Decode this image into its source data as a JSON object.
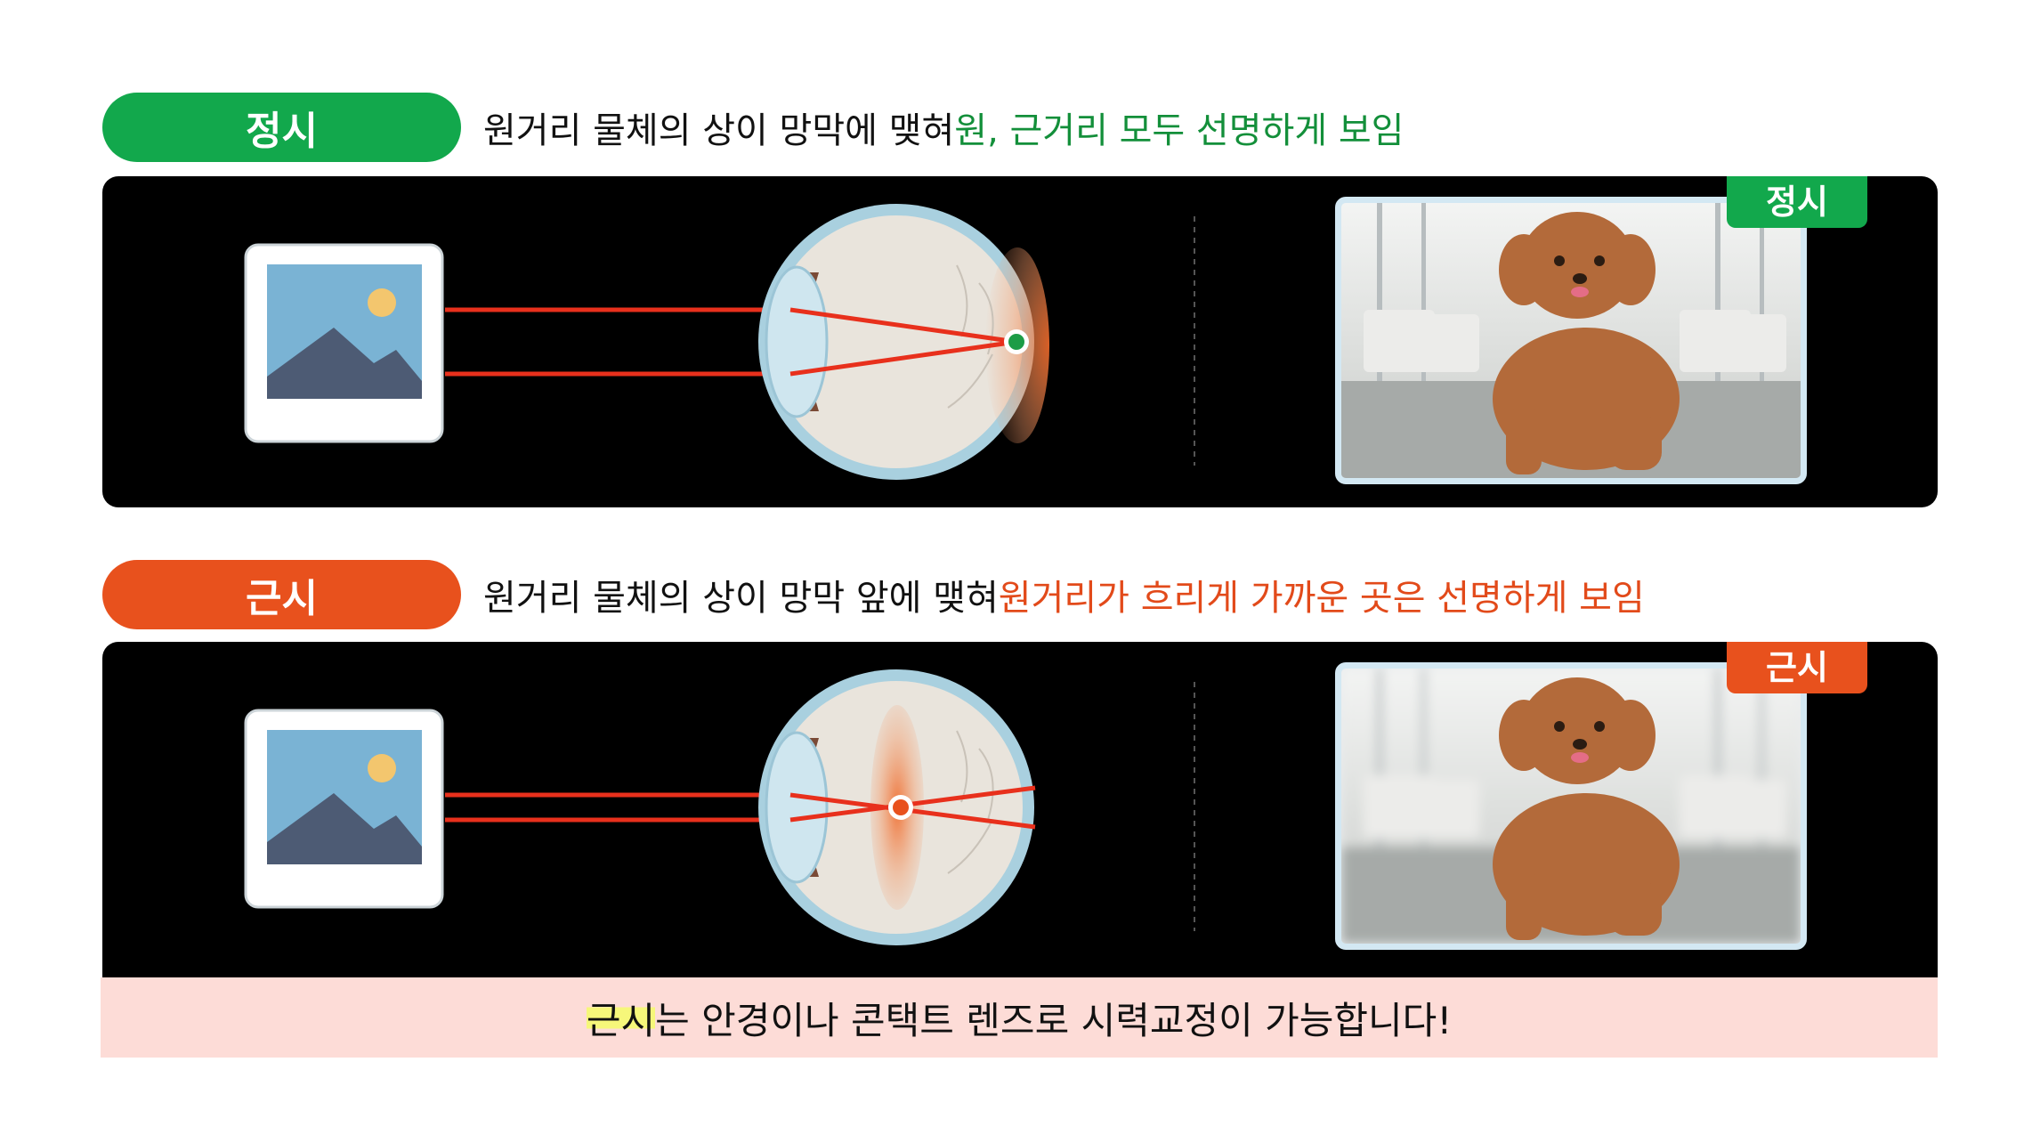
{
  "sections": [
    {
      "label": "정시",
      "desc_plain": "원거리 물체의 상이 망막에 맺혀 ",
      "desc_accent": "원, 근거리 모두 선명하게 보임",
      "badge": "정시",
      "color": "#12a84c"
    },
    {
      "label": "근시",
      "desc_plain": "원거리 물체의 상이 망막 앞에 맺혀 ",
      "desc_accent": "원거리가 흐리게 가까운 곳은 선명하게 보임",
      "badge": "근시",
      "color": "#e8511d"
    }
  ],
  "footer": {
    "highlight": "근시",
    "text": "는 안경이나 콘택트 렌즈로 시력교정이 가능합니다!"
  },
  "colors": {
    "panel_bg": "#000000",
    "ray": "#e8301c",
    "footer_bg": "#fddcd7"
  },
  "icons": [
    "image-icon",
    "eye-icon",
    "dog-photo"
  ]
}
